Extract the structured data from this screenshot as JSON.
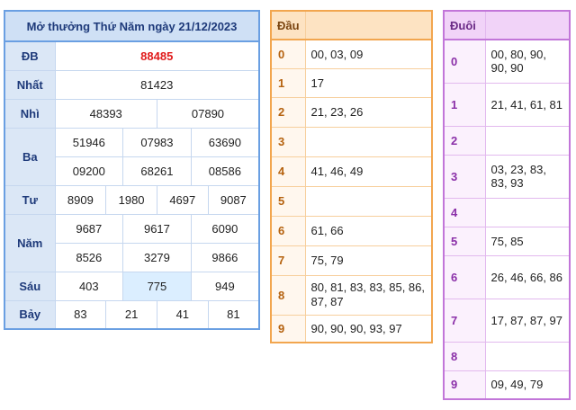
{
  "result": {
    "title": "Mở thưởng Thứ Năm ngày 21/12/2023",
    "rows": {
      "db": {
        "label": "ĐB",
        "values": [
          "88485"
        ]
      },
      "nhat": {
        "label": "Nhất",
        "values": [
          "81423"
        ]
      },
      "nhi": {
        "label": "Nhì",
        "values": [
          "48393",
          "07890"
        ]
      },
      "ba": {
        "label": "Ba",
        "values": [
          "51946",
          "07983",
          "63690",
          "09200",
          "68261",
          "08586"
        ]
      },
      "tu": {
        "label": "Tư",
        "values": [
          "8909",
          "1980",
          "4697",
          "9087"
        ]
      },
      "nam": {
        "label": "Năm",
        "values": [
          "9687",
          "9617",
          "6090",
          "8526",
          "3279",
          "9866"
        ]
      },
      "sau": {
        "label": "Sáu",
        "values": [
          "403",
          "775",
          "949"
        ]
      },
      "bay": {
        "label": "Bảy",
        "values": [
          "83",
          "21",
          "41",
          "81"
        ]
      }
    }
  },
  "dau": {
    "header": "Đầu",
    "rows": [
      {
        "digit": "0",
        "values": "00, 03, 09"
      },
      {
        "digit": "1",
        "values": "17"
      },
      {
        "digit": "2",
        "values": "21, 23, 26"
      },
      {
        "digit": "3",
        "values": ""
      },
      {
        "digit": "4",
        "values": "41, 46, 49"
      },
      {
        "digit": "5",
        "values": ""
      },
      {
        "digit": "6",
        "values": "61, 66"
      },
      {
        "digit": "7",
        "values": "75, 79"
      },
      {
        "digit": "8",
        "values": "80, 81, 83, 83, 85, 86, 87, 87"
      },
      {
        "digit": "9",
        "values": "90, 90, 90, 93, 97"
      }
    ]
  },
  "duoi": {
    "header": "Đuôi",
    "rows": [
      {
        "digit": "0",
        "values": "00, 80, 90, 90, 90"
      },
      {
        "digit": "1",
        "values": "21, 41, 61, 81"
      },
      {
        "digit": "2",
        "values": ""
      },
      {
        "digit": "3",
        "values": "03, 23, 83, 83, 93"
      },
      {
        "digit": "4",
        "values": ""
      },
      {
        "digit": "5",
        "values": "75, 85"
      },
      {
        "digit": "6",
        "values": "26, 46, 66, 86"
      },
      {
        "digit": "7",
        "values": "17, 87, 87, 97"
      },
      {
        "digit": "8",
        "values": ""
      },
      {
        "digit": "9",
        "values": "09, 49, 79"
      }
    ]
  },
  "colors": {
    "result_border": "#6a9fe2",
    "dau_border": "#f2a64f",
    "duoi_border": "#c276d9",
    "special_prize": "#e01b1b"
  }
}
